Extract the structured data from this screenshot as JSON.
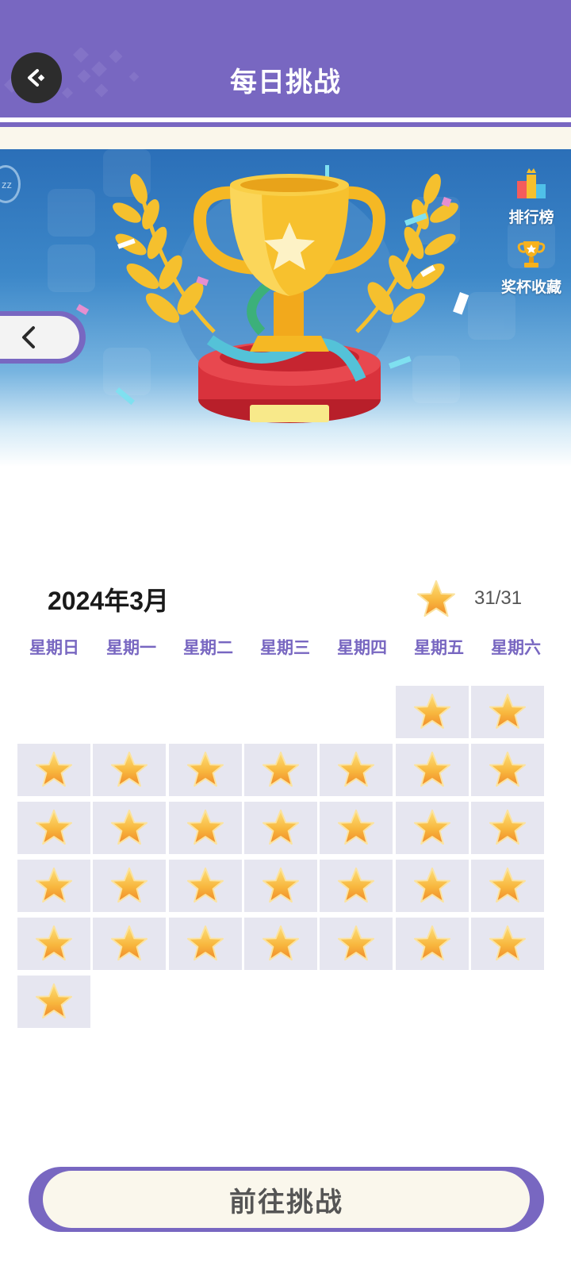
{
  "header": {
    "title": "每日挑战",
    "back_icon": "back-arrow-icon"
  },
  "banner": {
    "leaderboard_label": "排行榜",
    "trophy_collection_label": "奖杯收藏",
    "leaderboard_icon": "podium-icon",
    "trophy_icon": "trophy-icon",
    "badge_text": "zz",
    "prev_icon": "chevron-left-icon"
  },
  "calendar": {
    "month": "2024年3月",
    "progress": "31/31",
    "stars_earned": 31,
    "days_in_month": 31,
    "first_weekday_index": 5,
    "weekdays": [
      "星期日",
      "星期一",
      "星期二",
      "星期三",
      "星期四",
      "星期五",
      "星期六"
    ],
    "completed_icon": "star-icon"
  },
  "colors": {
    "brand_purple": "#7867c1",
    "cream": "#faf7ec",
    "cell_bg": "#e6e6f0",
    "star_gold": "#f7a93a"
  },
  "cta": {
    "label": "前往挑战"
  }
}
